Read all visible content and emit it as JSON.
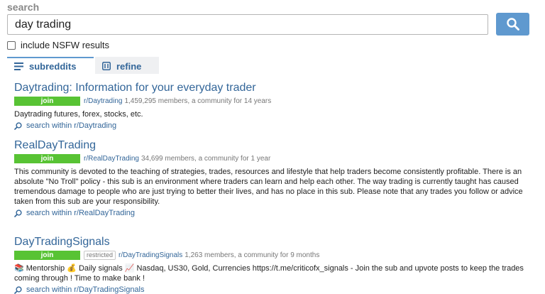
{
  "search": {
    "label": "search",
    "value": "day trading",
    "nsfw_label": "include NSFW results",
    "nsfw_checked": false
  },
  "tabs": [
    {
      "label": "subreddits",
      "icon": "list-icon",
      "active": true
    },
    {
      "label": "refine",
      "icon": "refine-icon",
      "active": false
    }
  ],
  "results": [
    {
      "title": "Daytrading: Information for your everyday trader",
      "join_label": "join",
      "subreddit": "r/Daytrading",
      "stats": "1,459,295 members, a community for 14 years",
      "description": "Daytrading futures, forex, stocks, etc.",
      "search_within": "search within r/Daytrading"
    },
    {
      "title": "RealDayTrading",
      "join_label": "join",
      "subreddit": "r/RealDayTrading",
      "stats": "34,699 members, a community for 1 year",
      "description": "This community is devoted to the teaching of strategies, trades, resources and lifestyle that help traders become consistently profitable. There is an absolute \"No Troll\" policy - this sub is an environment where traders can learn and help each other. The way trading is currently taught has caused tremendous damage to people who are just trying to better their lives, and has no place in this sub. Please note that any trades you follow or advice taken from this sub are your responsibility.",
      "search_within": "search within r/RealDayTrading"
    },
    {
      "title": "DayTradingSignals",
      "join_label": "join",
      "restricted_label": "restricted",
      "subreddit": "r/DayTradingSignals",
      "stats": "1,263 members, a community for 9 months",
      "description": "📚 Mentorship 💰 Daily signals 📈 Nasdaq, US30, Gold, Currencies https://t.me/criticofx_signals - Join the sub and upvote posts to keep the trades coming through ! Time to make bank !",
      "search_within": "search within r/DayTradingSignals"
    }
  ],
  "colors": {
    "link": "#336699",
    "join_button": "#58c334",
    "search_button": "#5f99cf"
  }
}
